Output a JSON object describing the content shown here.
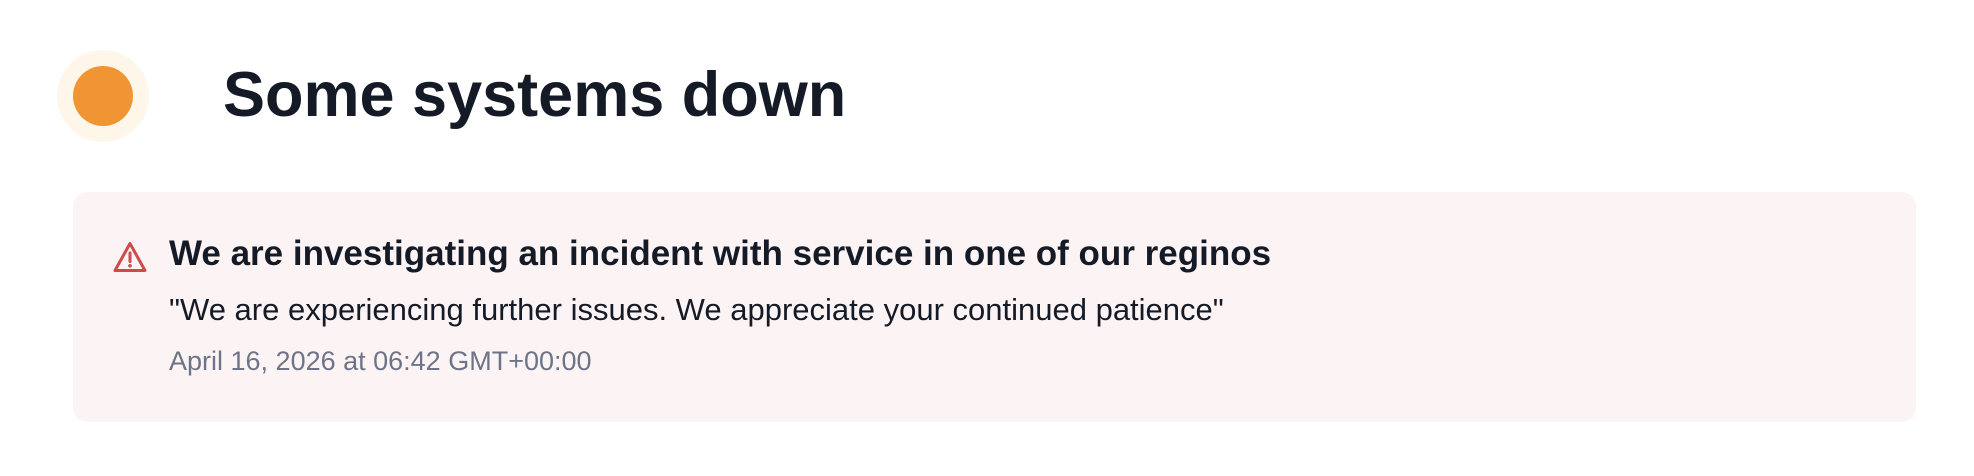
{
  "status": {
    "title": "Some systems down",
    "indicator_color": "#f19534",
    "indicator_halo_color": "#fdf6e9"
  },
  "incident": {
    "icon": "warning-triangle-icon",
    "icon_color": "#cc4b4b",
    "background_color": "#fcf4f4",
    "title": "We are investigating an incident with service in one of our reginos",
    "message": "\"We are experiencing further issues. We appreciate your continued patience\"",
    "timestamp": "April 16, 2026 at 06:42 GMT+00:00"
  }
}
